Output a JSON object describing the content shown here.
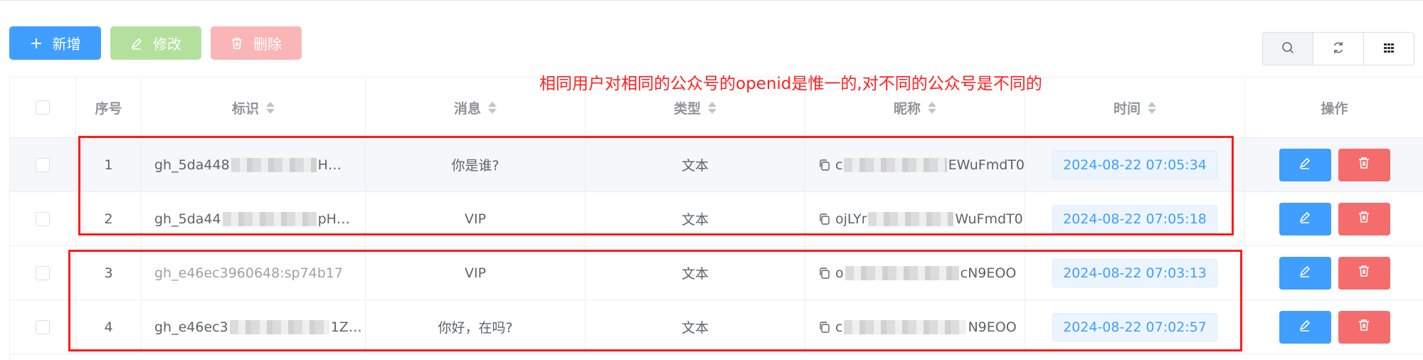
{
  "toolbar": {
    "add_label": "新增",
    "edit_label": "修改",
    "delete_label": "删除"
  },
  "table": {
    "headers": {
      "index": "序号",
      "identifier": "标识",
      "message": "消息",
      "type": "类型",
      "nickname": "昵称",
      "time": "时间",
      "actions": "操作"
    },
    "rows": [
      {
        "index": "1",
        "id_prefix": "gh_5da448",
        "id_suffix": "H…",
        "message": "你是谁?",
        "type": "文本",
        "nick_prefix": "c",
        "nick_suffix": "EWuFmdT0",
        "time": "2024-08-22 07:05:34"
      },
      {
        "index": "2",
        "id_prefix": "gh_5da44",
        "id_suffix": "pH…",
        "message": "VIP",
        "type": "文本",
        "nick_prefix": "ojLYr",
        "nick_suffix": "WuFmdT0",
        "time": "2024-08-22 07:05:18"
      },
      {
        "index": "3",
        "id_prefix": "gh_e46ec3960648:sp74b17",
        "id_suffix": "",
        "message": "VIP",
        "type": "文本",
        "nick_prefix": "o",
        "nick_suffix": "cN9EOO",
        "time": "2024-08-22 07:03:13"
      },
      {
        "index": "4",
        "id_prefix": "gh_e46ec3",
        "id_suffix": "1Z…",
        "message": "你好，在吗?",
        "type": "文本",
        "nick_prefix": "c",
        "nick_suffix": "N9EOO",
        "time": "2024-08-22 07:02:57"
      }
    ]
  },
  "annotation": {
    "text": "相同用户对相同的公众号的openid是惟一的,对不同的公众号是不同的",
    "color": "#ff2020"
  },
  "colors": {
    "primary": "#409eff",
    "success_light": "#b3e19d",
    "danger_light": "#fab6b6",
    "danger": "#f56c6c"
  }
}
